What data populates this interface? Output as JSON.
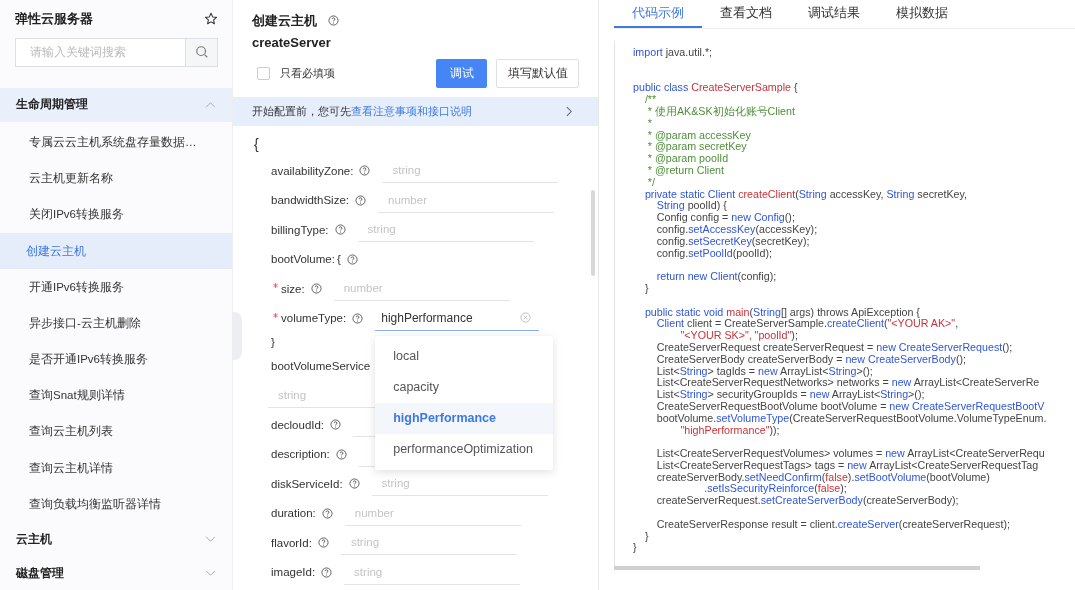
{
  "sidebar": {
    "title": "弹性云服务器",
    "search": {
      "placeholder": "请输入关键词搜索"
    },
    "groups": [
      {
        "title": "生命周期管理",
        "expanded": true,
        "items": [
          {
            "label": "专属云云主机系统盘存量数据…",
            "selected": false
          },
          {
            "label": "云主机更新名称",
            "selected": false
          },
          {
            "label": "关闭IPv6转换服务",
            "selected": false
          },
          {
            "label": "创建云主机",
            "selected": true
          },
          {
            "label": "开通IPv6转换服务",
            "selected": false
          },
          {
            "label": "异步接口-云主机删除",
            "selected": false
          },
          {
            "label": "是否开通IPv6转换服务",
            "selected": false
          },
          {
            "label": "查询Snat规则详情",
            "selected": false
          },
          {
            "label": "查询云主机列表",
            "selected": false
          },
          {
            "label": "查询云主机详情",
            "selected": false
          },
          {
            "label": "查询负载均衡监听器详情",
            "selected": false
          }
        ]
      },
      {
        "title": "云主机",
        "expanded": false
      },
      {
        "title": "磁盘管理",
        "expanded": false
      }
    ]
  },
  "api": {
    "title": "创建云主机",
    "name": "createServer",
    "required_only": {
      "label": "只看必填项",
      "checked": false
    },
    "buttons": [
      {
        "label": "调试",
        "kind": "primary"
      },
      {
        "label": "填写默认值",
        "kind": "default"
      }
    ],
    "notice": {
      "text": "开始配置前，您可先",
      "link": "查看注意事项和接口说明"
    },
    "form": {
      "open": "{",
      "fields": [
        {
          "kind": "field",
          "label": "availabilityZone:",
          "placeholder": "string",
          "required": false
        },
        {
          "kind": "field",
          "label": "bandwidthSize:",
          "placeholder": "number",
          "required": false
        },
        {
          "kind": "field",
          "label": "billingType:",
          "placeholder": "string",
          "required": false
        },
        {
          "kind": "object",
          "label": "bootVolume:",
          "open": "{",
          "close": "}",
          "children": [
            {
              "label": "size:",
              "placeholder": "number",
              "required": true
            },
            {
              "label": "volumeType:",
              "value": "highPerformance",
              "required": true,
              "dropdown": [
                {
                  "label": "local",
                  "selected": false
                },
                {
                  "label": "capacity",
                  "selected": false
                },
                {
                  "label": "highPerformance",
                  "selected": true
                },
                {
                  "label": "performanceOptimization",
                  "selected": false
                }
              ]
            }
          ]
        },
        {
          "kind": "block",
          "label": "bootVolumeService",
          "placeholder": "string",
          "required": false
        },
        {
          "kind": "field",
          "label": "decloudId:",
          "required": false
        },
        {
          "kind": "field",
          "label": "description:",
          "required": false
        },
        {
          "kind": "field",
          "label": "diskServiceId:",
          "placeholder": "string",
          "required": false
        },
        {
          "kind": "field",
          "label": "duration:",
          "placeholder": "number",
          "required": false
        },
        {
          "kind": "field",
          "label": "flavorId:",
          "placeholder": "string",
          "required": false
        },
        {
          "kind": "field",
          "label": "imageId:",
          "placeholder": "string",
          "required": false
        }
      ]
    }
  },
  "panel": {
    "tabs": [
      {
        "label": "代码示例",
        "selected": true
      },
      {
        "label": "查看文档",
        "selected": false
      },
      {
        "label": "调试结果",
        "selected": false
      },
      {
        "label": "模拟数据",
        "selected": false
      }
    ],
    "code": [
      {
        "kind": "code",
        "segs": [
          {
            "text": "import ",
            "kind": "kw"
          },
          {
            "text": "java.util.*;",
            "kind": "p"
          }
        ]
      },
      {
        "kind": "blank"
      },
      {
        "kind": "blank"
      },
      {
        "kind": "code",
        "segs": [
          {
            "text": "public class ",
            "kind": "kw"
          },
          {
            "text": "CreateServerSample",
            "kind": "name"
          },
          {
            "text": " {",
            "kind": "p"
          }
        ]
      },
      {
        "kind": "code",
        "segs": [
          {
            "text": "    /**",
            "kind": "cm"
          }
        ]
      },
      {
        "kind": "code",
        "segs": [
          {
            "text": "     * 使用AK&SK初始化账号Client",
            "kind": "cm"
          }
        ]
      },
      {
        "kind": "code",
        "segs": [
          {
            "text": "     *",
            "kind": "cm"
          }
        ]
      },
      {
        "kind": "code",
        "segs": [
          {
            "text": "     * @param accessKey",
            "kind": "cm"
          }
        ]
      },
      {
        "kind": "code",
        "segs": [
          {
            "text": "     * @param secretKey",
            "kind": "cm"
          }
        ]
      },
      {
        "kind": "code",
        "segs": [
          {
            "text": "     * @param poolId",
            "kind": "cm"
          }
        ]
      },
      {
        "kind": "code",
        "segs": [
          {
            "text": "     * @return Client",
            "kind": "cm"
          }
        ]
      },
      {
        "kind": "code",
        "segs": [
          {
            "text": "     */",
            "kind": "cm"
          }
        ]
      },
      {
        "kind": "code",
        "segs": [
          {
            "text": "    private static Client ",
            "kind": "kw"
          },
          {
            "text": "createClient",
            "kind": "name"
          },
          {
            "text": "(",
            "kind": "p"
          },
          {
            "text": "String ",
            "kind": "kw"
          },
          {
            "text": "accessKey, ",
            "kind": "p"
          },
          {
            "text": "String ",
            "kind": "kw"
          },
          {
            "text": "secretKey,",
            "kind": "p"
          }
        ]
      },
      {
        "kind": "code",
        "segs": [
          {
            "text": "        String ",
            "kind": "kw"
          },
          {
            "text": "poolId) {",
            "kind": "p"
          }
        ]
      },
      {
        "kind": "code",
        "segs": [
          {
            "text": "        Config config = ",
            "kind": "p"
          },
          {
            "text": "new Config",
            "kind": "kw"
          },
          {
            "text": "();",
            "kind": "p"
          }
        ]
      },
      {
        "kind": "code",
        "segs": [
          {
            "text": "        config.",
            "kind": "p"
          },
          {
            "text": "setAccessKey",
            "kind": "kw"
          },
          {
            "text": "(accessKey);",
            "kind": "p"
          }
        ]
      },
      {
        "kind": "code",
        "segs": [
          {
            "text": "        config.",
            "kind": "p"
          },
          {
            "text": "setSecretKey",
            "kind": "kw"
          },
          {
            "text": "(secretKey);",
            "kind": "p"
          }
        ]
      },
      {
        "kind": "code",
        "segs": [
          {
            "text": "        config.",
            "kind": "p"
          },
          {
            "text": "setPoolId",
            "kind": "kw"
          },
          {
            "text": "(poolId);",
            "kind": "p"
          }
        ]
      },
      {
        "kind": "blank"
      },
      {
        "kind": "code",
        "segs": [
          {
            "text": "        return new Client",
            "kind": "kw"
          },
          {
            "text": "(config);",
            "kind": "p"
          }
        ]
      },
      {
        "kind": "code",
        "segs": [
          {
            "text": "    }",
            "kind": "p"
          }
        ]
      },
      {
        "kind": "blank"
      },
      {
        "kind": "code",
        "segs": [
          {
            "text": "    public static void ",
            "kind": "kw"
          },
          {
            "text": "main",
            "kind": "name"
          },
          {
            "text": "(",
            "kind": "p"
          },
          {
            "text": "String",
            "kind": "kw"
          },
          {
            "text": "[] args) throws ApiException {",
            "kind": "p"
          }
        ]
      },
      {
        "kind": "code",
        "segs": [
          {
            "text": "        Client ",
            "kind": "kw"
          },
          {
            "text": "client = CreateServerSample.",
            "kind": "p"
          },
          {
            "text": "createClient",
            "kind": "kw"
          },
          {
            "text": "(",
            "kind": "p"
          },
          {
            "text": "\"<YOUR AK>\"",
            "kind": "str"
          },
          {
            "text": ",",
            "kind": "p"
          }
        ]
      },
      {
        "kind": "code",
        "segs": [
          {
            "text": "                \"<YOUR SK>\", \"poolId\"",
            "kind": "str"
          },
          {
            "text": ");",
            "kind": "p"
          }
        ]
      },
      {
        "kind": "code",
        "segs": [
          {
            "text": "        CreateServerRequest createServerRequest = ",
            "kind": "p"
          },
          {
            "text": "new CreateServerRequest",
            "kind": "kw"
          },
          {
            "text": "();",
            "kind": "p"
          }
        ]
      },
      {
        "kind": "code",
        "segs": [
          {
            "text": "        CreateServerBody createServerBody = ",
            "kind": "p"
          },
          {
            "text": "new CreateServerBody",
            "kind": "kw"
          },
          {
            "text": "();",
            "kind": "p"
          }
        ]
      },
      {
        "kind": "code",
        "segs": [
          {
            "text": "        List<",
            "kind": "p"
          },
          {
            "text": "String",
            "kind": "kw"
          },
          {
            "text": "> tagIds = ",
            "kind": "p"
          },
          {
            "text": "new ",
            "kind": "kw"
          },
          {
            "text": "ArrayList<",
            "kind": "p"
          },
          {
            "text": "String",
            "kind": "kw"
          },
          {
            "text": ">();",
            "kind": "p"
          }
        ]
      },
      {
        "kind": "code",
        "segs": [
          {
            "text": "        List<CreateServerRequestNetworks> networks = ",
            "kind": "p"
          },
          {
            "text": "new ",
            "kind": "kw"
          },
          {
            "text": "ArrayList<CreateServerRe",
            "kind": "p"
          }
        ]
      },
      {
        "kind": "code",
        "segs": [
          {
            "text": "        List<",
            "kind": "p"
          },
          {
            "text": "String",
            "kind": "kw"
          },
          {
            "text": "> securityGroupIds = ",
            "kind": "p"
          },
          {
            "text": "new ",
            "kind": "kw"
          },
          {
            "text": "ArrayList<",
            "kind": "p"
          },
          {
            "text": "String",
            "kind": "kw"
          },
          {
            "text": ">();",
            "kind": "p"
          }
        ]
      },
      {
        "kind": "code",
        "segs": [
          {
            "text": "        CreateServerRequestBootVolume bootVolume = ",
            "kind": "p"
          },
          {
            "text": "new CreateServerRequestBootV",
            "kind": "kw"
          }
        ]
      },
      {
        "kind": "code",
        "segs": [
          {
            "text": "        bootVolume.",
            "kind": "p"
          },
          {
            "text": "setVolumeType",
            "kind": "kw"
          },
          {
            "text": "(CreateServerRequestBootVolume.VolumeTypeEnum.",
            "kind": "p"
          }
        ]
      },
      {
        "kind": "code",
        "segs": [
          {
            "text": "                \"highPerformance\"",
            "kind": "str"
          },
          {
            "text": "));",
            "kind": "p"
          }
        ]
      },
      {
        "kind": "blank"
      },
      {
        "kind": "code",
        "segs": [
          {
            "text": "        List<CreateServerRequestVolumes> volumes = ",
            "kind": "p"
          },
          {
            "text": "new ",
            "kind": "kw"
          },
          {
            "text": "ArrayList<CreateServerRequ",
            "kind": "p"
          }
        ]
      },
      {
        "kind": "code",
        "segs": [
          {
            "text": "        List<CreateServerRequestTags> tags = ",
            "kind": "p"
          },
          {
            "text": "new ",
            "kind": "kw"
          },
          {
            "text": "ArrayList<CreateServerRequestTag",
            "kind": "p"
          }
        ]
      },
      {
        "kind": "code",
        "segs": [
          {
            "text": "        createServerBody.",
            "kind": "p"
          },
          {
            "text": "setNeedConfirm",
            "kind": "kw"
          },
          {
            "text": "(",
            "kind": "p"
          },
          {
            "text": "false",
            "kind": "str"
          },
          {
            "text": ").",
            "kind": "p"
          },
          {
            "text": "setBootVolume",
            "kind": "kw"
          },
          {
            "text": "(bootVolume)",
            "kind": "p"
          }
        ]
      },
      {
        "kind": "code",
        "segs": [
          {
            "text": "                        .setIsSecurityReinforce",
            "kind": "kw"
          },
          {
            "text": "(",
            "kind": "p"
          },
          {
            "text": "false",
            "kind": "str"
          },
          {
            "text": ");",
            "kind": "p"
          }
        ]
      },
      {
        "kind": "code",
        "segs": [
          {
            "text": "        createServerRequest.",
            "kind": "p"
          },
          {
            "text": "setCreateServerBody",
            "kind": "kw"
          },
          {
            "text": "(createServerBody);",
            "kind": "p"
          }
        ]
      },
      {
        "kind": "blank"
      },
      {
        "kind": "code",
        "segs": [
          {
            "text": "        CreateServerResponse result = client.",
            "kind": "p"
          },
          {
            "text": "createServer",
            "kind": "kw"
          },
          {
            "text": "(createServerRequest);",
            "kind": "p"
          }
        ]
      },
      {
        "kind": "code",
        "segs": [
          {
            "text": "    }",
            "kind": "p"
          }
        ]
      },
      {
        "kind": "code",
        "segs": [
          {
            "text": "}",
            "kind": "p"
          }
        ]
      }
    ]
  }
}
